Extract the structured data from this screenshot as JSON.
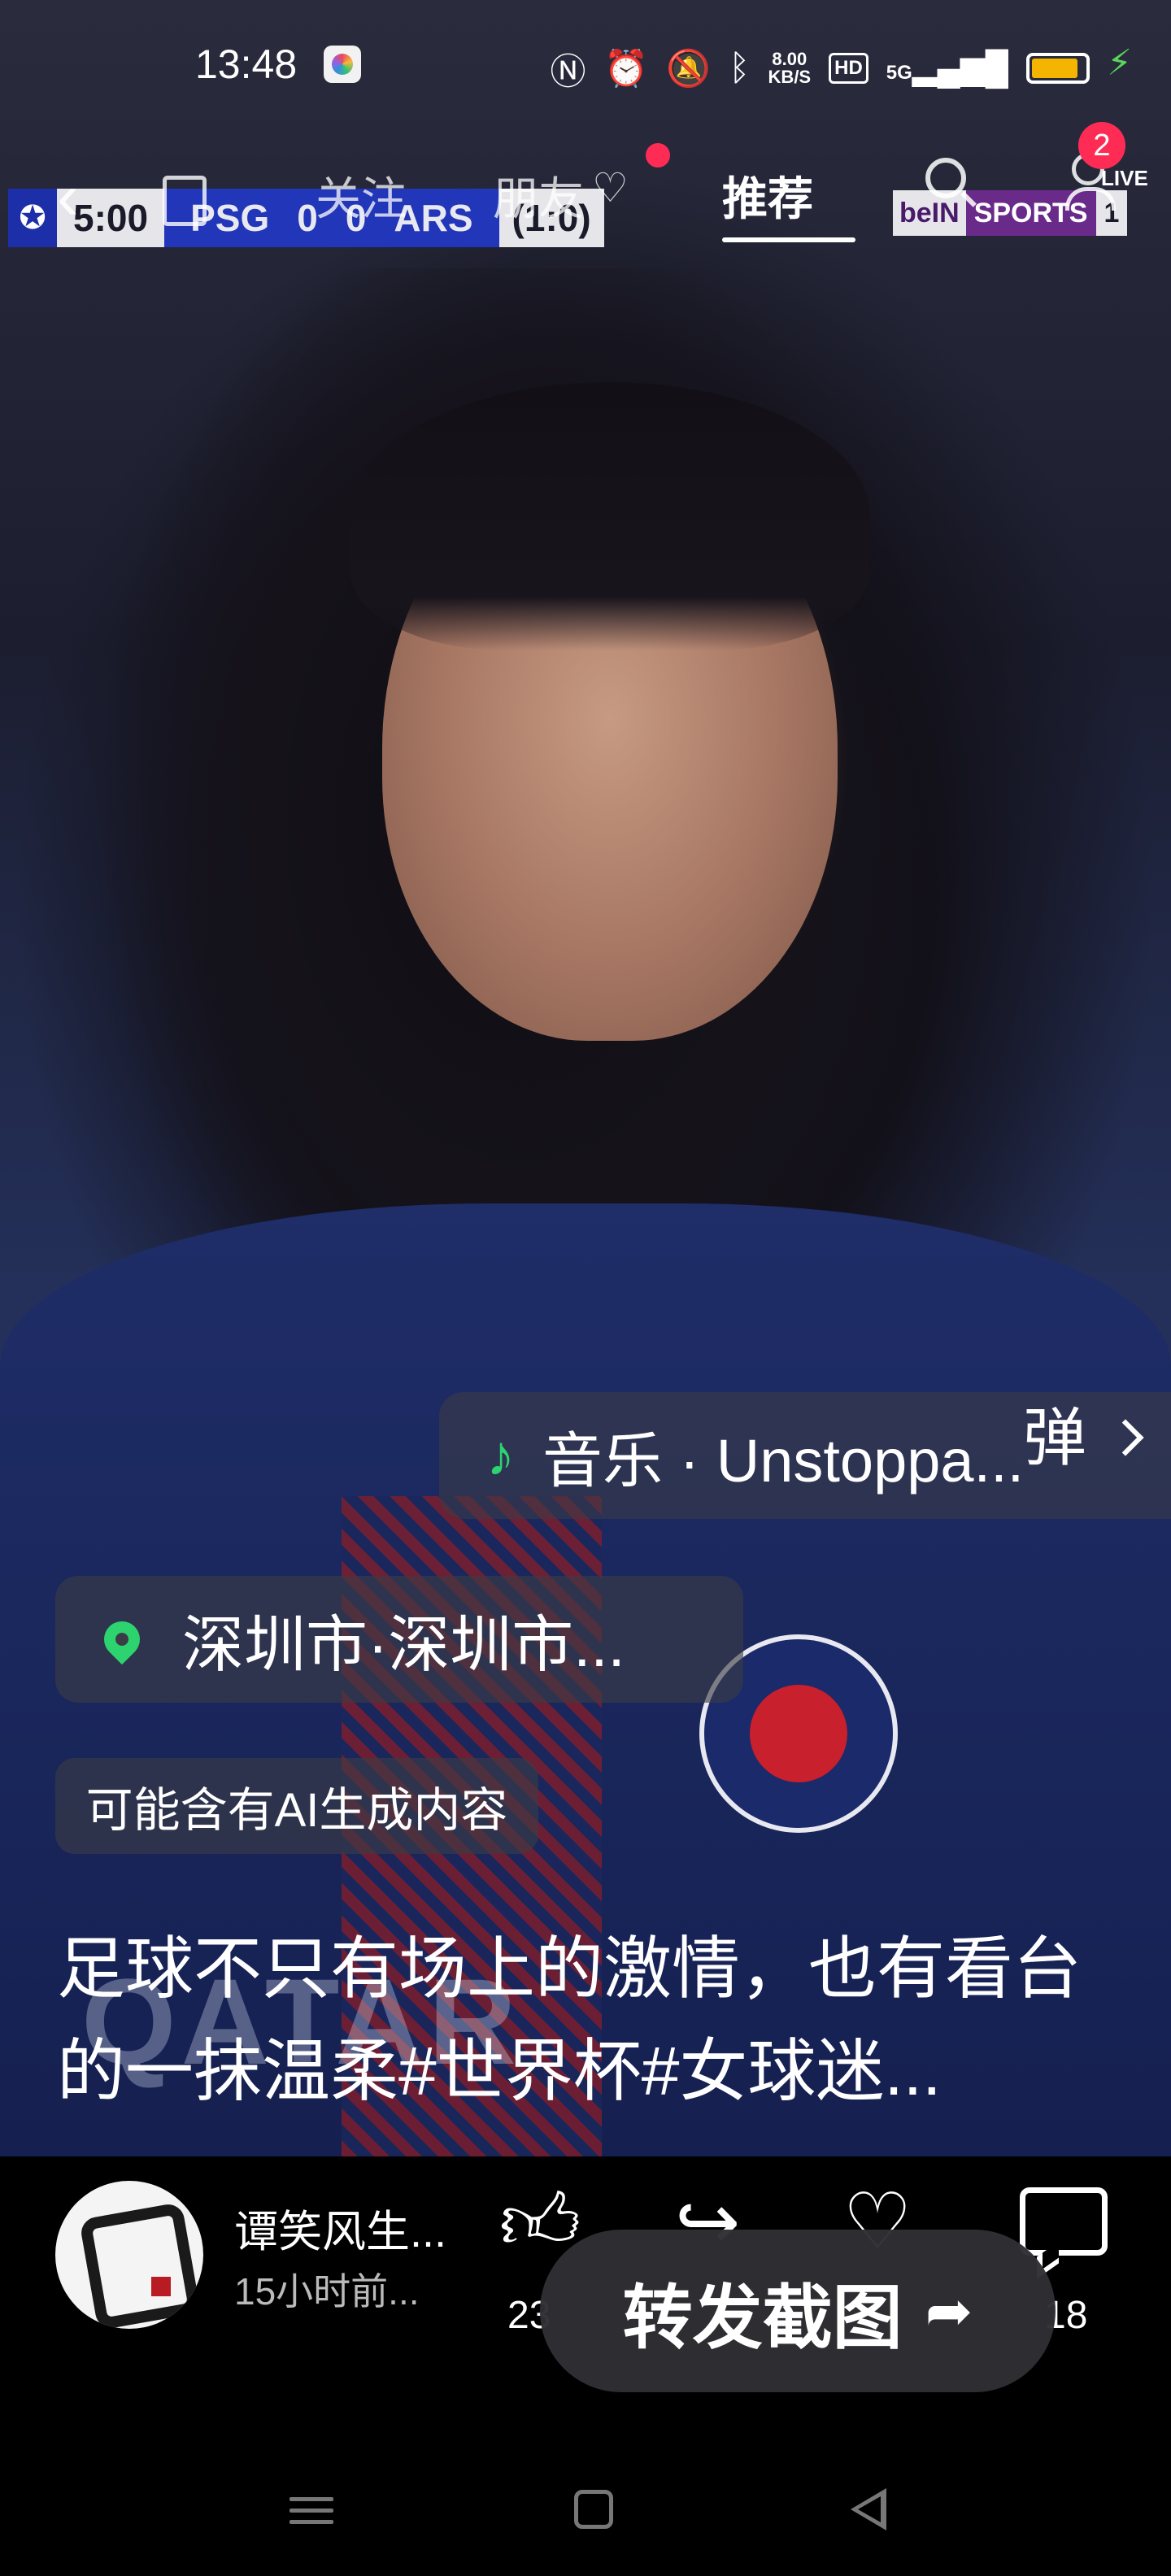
{
  "status_bar": {
    "time": "13:48",
    "net_speed_value": "8.00",
    "net_speed_unit": "KB/S",
    "hd_label": "HD",
    "signal_label": "5G"
  },
  "scoreboard": {
    "clock": "5:00",
    "home_team": "PSG",
    "home_score": "0",
    "away_score": "0",
    "away_team": "ARS",
    "aggregate": "(1:0)",
    "broadcaster_part1": "beIN",
    "broadcaster_part2": "SPORTS",
    "broadcaster_channel": "1",
    "live_label": "LIVE"
  },
  "top_nav": {
    "tabs": [
      {
        "label": "关注"
      },
      {
        "label": "朋友"
      },
      {
        "label": "推荐"
      }
    ],
    "active_tab": "推荐",
    "friend_tab_has_dot": true,
    "notification_count": "2"
  },
  "video_overlay": {
    "jersey_sponsor": "QATAR",
    "music": "音乐 · Unstoppa...",
    "danmu_label": "弹",
    "location": "深圳市·深圳市...",
    "ai_notice": "可能含有AI生成内容",
    "caption": "足球不只有场上的激情，也有看台的一抹温柔#世界杯#女球迷..."
  },
  "author": {
    "name": "谭笑风生...",
    "posted": "15小时前..."
  },
  "actions": {
    "like_count": "23",
    "comment_count": "18",
    "share_screenshot_label": "转发截图"
  },
  "colors": {
    "accent_red": "#fe2c55",
    "accent_green": "#2dd36f",
    "battery_yellow": "#f4b400"
  },
  "battery_level": 0.8
}
